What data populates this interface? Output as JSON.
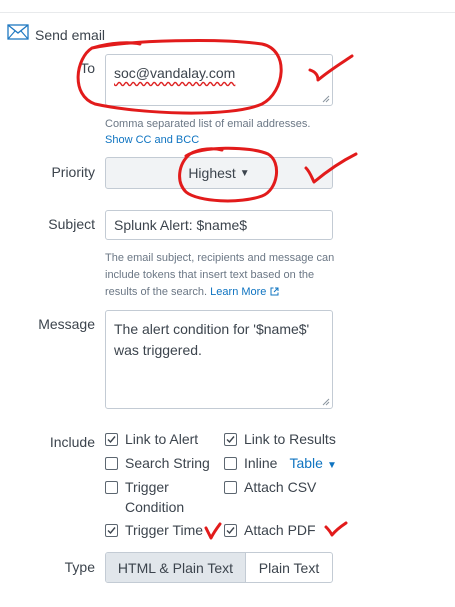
{
  "header": {
    "title": "Send email",
    "icon": "envelope-icon"
  },
  "to": {
    "label": "To",
    "value": "soc@vandalay.com",
    "help": "Comma separated list of email addresses.",
    "cc_link": "Show CC and BCC"
  },
  "priority": {
    "label": "Priority",
    "value": "Highest"
  },
  "subject": {
    "label": "Subject",
    "value": "Splunk Alert: $name$",
    "help": "The email subject, recipients and message can include tokens that insert text based on the results of the search.",
    "learn_more": "Learn More"
  },
  "message": {
    "label": "Message",
    "value": "The alert condition for '$name$' was triggered."
  },
  "include": {
    "label": "Include",
    "options": [
      {
        "label": "Link to Alert",
        "checked": true
      },
      {
        "label": "Link to Results",
        "checked": true
      },
      {
        "label": "Search String",
        "checked": false
      },
      {
        "label": "Inline",
        "checked": false
      },
      {
        "label": "Trigger Condition",
        "checked": false
      },
      {
        "label": "Attach CSV",
        "checked": false
      },
      {
        "label": "Trigger Time",
        "checked": true
      },
      {
        "label": "Attach PDF",
        "checked": true
      }
    ],
    "inline_format": "Table"
  },
  "type": {
    "label": "Type",
    "options": [
      "HTML & Plain Text",
      "Plain Text"
    ],
    "selected": "HTML & Plain Text"
  },
  "colors": {
    "link": "#0f74c1",
    "annotation": "#e21b1b",
    "border": "#c3cbd4"
  }
}
